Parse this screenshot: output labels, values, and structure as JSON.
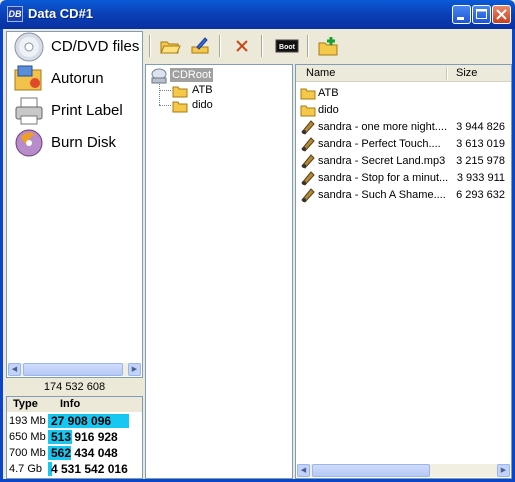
{
  "window": {
    "title": "Data CD#1",
    "app_icon_text": "DB"
  },
  "nav": {
    "items": [
      {
        "label": "CD/DVD files",
        "icon": "cd-disc-icon"
      },
      {
        "label": "Autorun",
        "icon": "autorun-icon"
      },
      {
        "label": "Print Label",
        "icon": "printer-icon"
      },
      {
        "label": "Burn Disk",
        "icon": "burn-disc-icon"
      }
    ]
  },
  "disk": {
    "total": "174 532 608",
    "headers": {
      "type": "Type",
      "info": "Info"
    },
    "rows": [
      {
        "type": "193 Mb",
        "info": "27 908 096",
        "fill": 0.9
      },
      {
        "type": "650 Mb",
        "info": "513 916 928",
        "fill": 0.27
      },
      {
        "type": "700 Mb",
        "info": "562 434 048",
        "fill": 0.25
      },
      {
        "type": "4.7 Gb",
        "info": "4 531 542 016",
        "fill": 0.04
      }
    ]
  },
  "toolbar": {
    "items": [
      "open-folder-icon",
      "rename-icon",
      "delete-icon",
      "boot-icon",
      "new-folder-icon"
    ],
    "boot_label": "Boot"
  },
  "tree": {
    "root": "CDRoot",
    "children": [
      "ATB",
      "dido"
    ]
  },
  "files": {
    "columns": {
      "name": "Name",
      "size": "Size"
    },
    "rows": [
      {
        "name": "ATB",
        "size": "",
        "kind": "folder"
      },
      {
        "name": "dido",
        "size": "",
        "kind": "folder"
      },
      {
        "name": "sandra - one more night....",
        "size": "3 944 826",
        "kind": "audio"
      },
      {
        "name": "sandra - Perfect Touch....",
        "size": "3 613 019",
        "kind": "audio"
      },
      {
        "name": "sandra - Secret Land.mp3",
        "size": "3 215 978",
        "kind": "audio"
      },
      {
        "name": "sandra - Stop for a minut...",
        "size": "3 933 911",
        "kind": "audio"
      },
      {
        "name": "sandra - Such A Shame....",
        "size": "6 293 632",
        "kind": "audio"
      }
    ]
  },
  "colors": {
    "titlebar": "#0a46c9",
    "disk_bar": "#16c7f2",
    "selection": "#a0a0a0"
  }
}
